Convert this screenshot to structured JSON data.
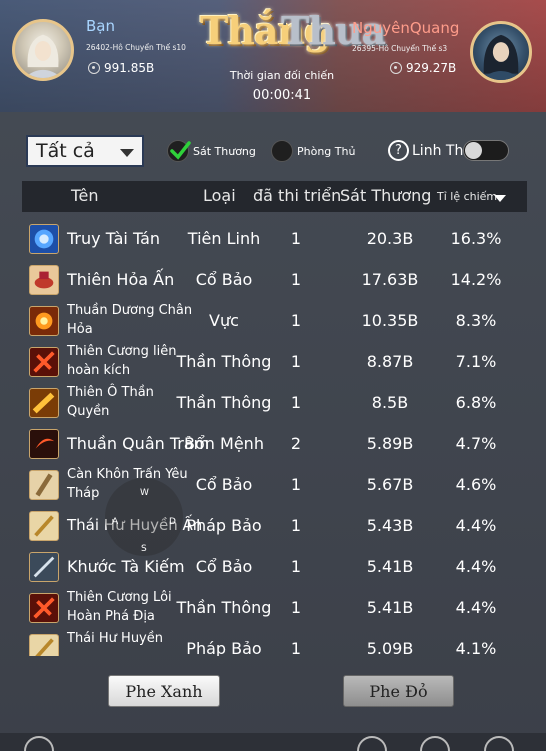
{
  "header": {
    "left_player": {
      "name": "Bạn",
      "server": "26402-Hô Chuyển Thế s10",
      "power": "991.85B"
    },
    "right_player": {
      "name": "NguyênQuang",
      "server": "26395-Hô Chuyển Thế s3",
      "power": "929.27B"
    },
    "win_label": "Thắng",
    "lose_label": "Thua",
    "battle_time_label": "Thời gian đối chiến",
    "battle_time": "00:00:41"
  },
  "filters": {
    "dropdown_value": "Tất cả",
    "damage_label": "Sát Thương",
    "defense_label": "Phòng Thủ",
    "help_icon": "?",
    "pet_label": "Linh Thú",
    "pet_toggle_on": false
  },
  "table": {
    "headers": {
      "name": "Tên",
      "type": "Loại",
      "count": "đã thi triển",
      "damage": "Sát Thương",
      "rate": "Tỉ lệ chiếm"
    },
    "rows": [
      {
        "name": "Truy Tài Tán",
        "type": "Tiên Linh",
        "count": "1",
        "damage": "20.3B",
        "rate": "16.3%",
        "icon": "blue-orb-icon",
        "color": "#2b6fd6"
      },
      {
        "name": "Thiên Hỏa Ấn",
        "type": "Cổ Bảo",
        "count": "1",
        "damage": "17.63B",
        "rate": "14.2%",
        "icon": "fire-seal-icon",
        "color": "#d9a06b"
      },
      {
        "name": "Thuần Dương Chân Hỏa",
        "type": "Vực",
        "count": "1",
        "damage": "10.35B",
        "rate": "8.3%",
        "icon": "sun-fire-icon",
        "color": "#e0620f"
      },
      {
        "name": "Thiên Cương liên hoàn kích",
        "type": "Thần Thông",
        "count": "1",
        "damage": "8.87B",
        "rate": "7.1%",
        "icon": "red-strike-icon",
        "color": "#c2281c"
      },
      {
        "name": "Thiên Ô Thần Quyền",
        "type": "Thần Thông",
        "count": "1",
        "damage": "8.5B",
        "rate": "6.8%",
        "icon": "golden-fist-icon",
        "color": "#d98a14"
      },
      {
        "name": "Thuần Quân Trảm",
        "type": "Bổn Mệnh",
        "count": "2",
        "damage": "5.89B",
        "rate": "4.7%",
        "icon": "crescent-slash-icon",
        "color": "#b8321c"
      },
      {
        "name": "Càn Khôn Trấn Yêu Tháp",
        "type": "Cổ Bảo",
        "count": "1",
        "damage": "5.67B",
        "rate": "4.6%",
        "icon": "tower-icon",
        "color": "#c9a777"
      },
      {
        "name": "Thái Hư Huyền Ấn",
        "type": "Pháp Bảo",
        "count": "1",
        "damage": "5.43B",
        "rate": "4.4%",
        "icon": "gold-staff-icon",
        "color": "#d6b56f"
      },
      {
        "name": "Khước Tà Kiếm",
        "type": "Cổ Bảo",
        "count": "1",
        "damage": "5.41B",
        "rate": "4.4%",
        "icon": "sword-icon",
        "color": "#7a8ea3"
      },
      {
        "name": "Thiên Cương Lôi Hoàn Phá Địa",
        "type": "Thần Thông",
        "count": "1",
        "damage": "5.41B",
        "rate": "4.4%",
        "icon": "red-strike-icon",
        "color": "#c2281c"
      },
      {
        "name": "Thái Hư Huyền",
        "type": "Pháp Bảo",
        "count": "1",
        "damage": "5.09B",
        "rate": "4.1%",
        "icon": "gold-staff-icon",
        "color": "#d6b56f"
      }
    ]
  },
  "joystick": {
    "up": "W",
    "left": "A",
    "right": "D",
    "down": "S"
  },
  "buttons": {
    "blue_side": "Phe Xanh",
    "red_side": "Phe Đỏ"
  }
}
